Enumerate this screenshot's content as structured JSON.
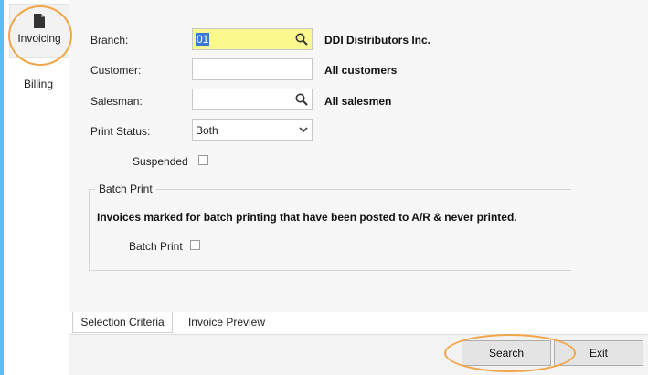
{
  "nav": {
    "items": [
      {
        "label": "Invoicing",
        "icon": "document-icon",
        "active": true
      },
      {
        "label": "Billing",
        "active": false
      }
    ]
  },
  "form": {
    "branch": {
      "label": "Branch:",
      "value": "01",
      "description": "DDI Distributors Inc."
    },
    "customer": {
      "label": "Customer:",
      "value": "",
      "description": "All customers"
    },
    "salesman": {
      "label": "Salesman:",
      "value": "",
      "description": "All salesmen"
    },
    "print_status": {
      "label": "Print Status:",
      "value": "Both"
    },
    "suspended": {
      "label": "Suspended",
      "checked": false
    }
  },
  "batch_print": {
    "group_title": "Batch Print",
    "description": "Invoices marked for batch printing that have been posted to A/R & never printed.",
    "checkbox_label": "Batch Print",
    "checked": false
  },
  "tabs": [
    {
      "label": "Selection Criteria",
      "active": true
    },
    {
      "label": "Invoice Preview",
      "active": false
    }
  ],
  "buttons": {
    "search": "Search",
    "exit": "Exit"
  },
  "colors": {
    "accent_bar": "#5bc0eb",
    "highlight_ring": "#f2a649",
    "active_input": "#fbf88f",
    "text_selection": "#3a77d5"
  }
}
